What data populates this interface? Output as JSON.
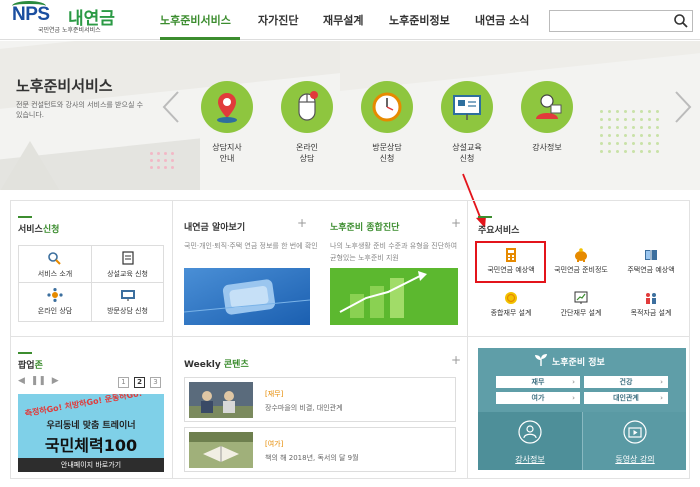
{
  "header": {
    "logo_text": "NPS",
    "logo_korean": "내연금",
    "logo_sub": "국민연금 노후준비서비스",
    "nav": [
      "노후준비서비스",
      "자가진단",
      "재무설계",
      "노후준비정보",
      "내연금 소식"
    ]
  },
  "banner": {
    "title": "노후준비서비스",
    "desc": "전문 컨설턴트와 강사의 서비스를 받으실 수 있습니다.",
    "services": [
      {
        "label": "상담지사\n안내",
        "icon": "map-pin-icon"
      },
      {
        "label": "온라인\n상담",
        "icon": "mouse-icon"
      },
      {
        "label": "방문상담\n신청",
        "icon": "clock-icon"
      },
      {
        "label": "상설교육\n신청",
        "icon": "presentation-board-icon"
      },
      {
        "label": "강사정보",
        "icon": "person-icon"
      }
    ]
  },
  "service_apply": {
    "title_a": "서비스",
    "title_b": "신청",
    "items": [
      "서비스 소개",
      "상설교육 신청",
      "온라인 상담",
      "방문상담 신청"
    ]
  },
  "pension_know": {
    "title": "내연금 알아보기",
    "desc": "국민·개인·퇴직·주택 연금 정보를 한 번에 확인"
  },
  "comprehensive": {
    "title_a": "노후준비 ",
    "title_b": "종합진단",
    "desc": "나의 노후생활 준비 수준과 유형을 진단하여 균형있는 노후준비 지원"
  },
  "main_services": {
    "title": "주요서비스",
    "items": [
      "국민연금 예상액",
      "국민연금 준비정도",
      "주택연금 예상액",
      "종합재무 설계",
      "간단재무 설계",
      "목적자금 설계"
    ]
  },
  "popup_zone": {
    "title_a": "팝업",
    "title_b": "존",
    "pages": [
      "1",
      "2",
      "3"
    ],
    "banner_top": "우리동네 맞춤 트레이너",
    "banner_big": "국민체력100",
    "banner_link": "안내페이지 바로가기",
    "slogan": "측정하Go! 처방하Go! 운동하Go!"
  },
  "weekly": {
    "title_a": "Weekly ",
    "title_b": "콘텐츠",
    "items": [
      {
        "cat": "[재무]",
        "text": "장수마을의 비결, 대인관계"
      },
      {
        "cat": "[여가]",
        "text": "책의 해 2018년, 독서의 달 9월"
      }
    ]
  },
  "info": {
    "title": "노후준비 정보",
    "buttons": [
      "재무",
      "건강",
      "여가",
      "대인관계"
    ],
    "bottom": [
      "강사정보",
      "동영상 강의"
    ]
  },
  "colors": {
    "accent": "#3c8d2f",
    "highlight": "#e3141b",
    "info_bg": "#5f9ea8"
  }
}
